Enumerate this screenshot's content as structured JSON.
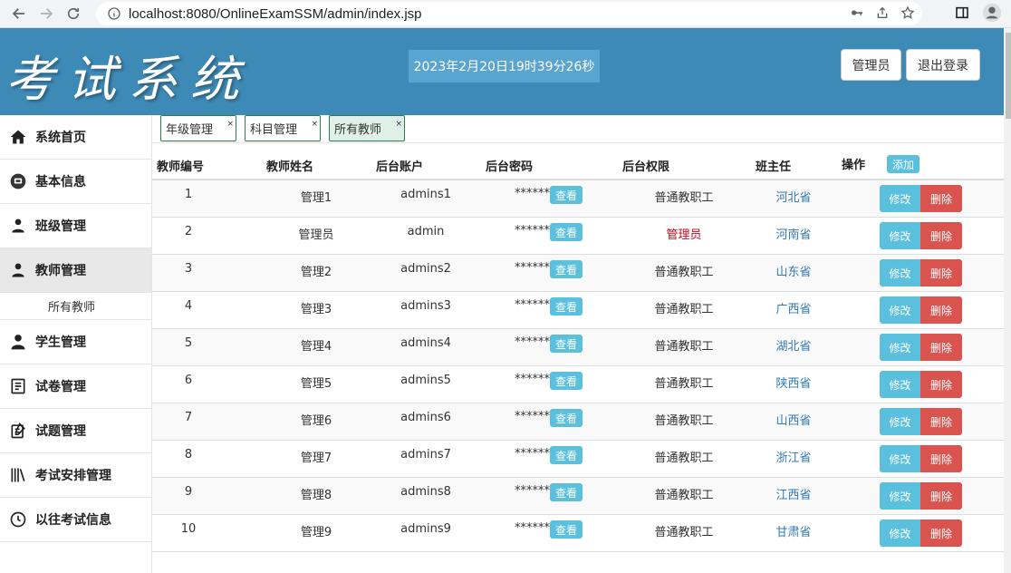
{
  "browser": {
    "url": "localhost:8080/OnlineExamSSM/admin/index.jsp"
  },
  "header": {
    "logo": "考试系统",
    "datetime": "2023年2月20日19时39分26秒",
    "role_button": "管理员",
    "logout_button": "退出登录",
    "bg_color": "#3e8ab6"
  },
  "sidebar": {
    "items": [
      {
        "label": "系统首页",
        "icon": "home-icon"
      },
      {
        "label": "基本信息",
        "icon": "info-icon"
      },
      {
        "label": "班级管理",
        "icon": "user-icon"
      },
      {
        "label": "教师管理",
        "icon": "user-icon"
      },
      {
        "label": "学生管理",
        "icon": "user-icon"
      },
      {
        "label": "试卷管理",
        "icon": "paper-icon"
      },
      {
        "label": "试题管理",
        "icon": "edit-paper-icon"
      },
      {
        "label": "考试安排管理",
        "icon": "books-icon"
      },
      {
        "label": "以往考试信息",
        "icon": "clock-icon"
      }
    ],
    "active_sub": "所有教师"
  },
  "tabs": [
    {
      "label": "年级管理"
    },
    {
      "label": "科目管理"
    },
    {
      "label": "所有教师"
    }
  ],
  "tab_close": "×",
  "table": {
    "headers": {
      "id": "教师编号",
      "name": "教师姓名",
      "account": "后台账户",
      "password": "后台密码",
      "permission": "后台权限",
      "head_teacher": "班主任",
      "actions": "操作"
    },
    "add_button": "添加",
    "view_button": "查看",
    "edit_button": "修改",
    "delete_button": "删除",
    "rows": [
      {
        "id": "1",
        "name": "管理1",
        "account": "admins1",
        "password": "******",
        "permission": "普通教职工",
        "head_teacher": "河北省"
      },
      {
        "id": "2",
        "name": "管理员",
        "account": "admin",
        "password": "******",
        "permission": "管理员",
        "head_teacher": "河南省"
      },
      {
        "id": "3",
        "name": "管理2",
        "account": "admins2",
        "password": "******",
        "permission": "普通教职工",
        "head_teacher": "山东省"
      },
      {
        "id": "4",
        "name": "管理3",
        "account": "admins3",
        "password": "******",
        "permission": "普通教职工",
        "head_teacher": "广西省"
      },
      {
        "id": "5",
        "name": "管理4",
        "account": "admins4",
        "password": "******",
        "permission": "普通教职工",
        "head_teacher": "湖北省"
      },
      {
        "id": "6",
        "name": "管理5",
        "account": "admins5",
        "password": "******",
        "permission": "普通教职工",
        "head_teacher": "陕西省"
      },
      {
        "id": "7",
        "name": "管理6",
        "account": "admins6",
        "password": "******",
        "permission": "普通教职工",
        "head_teacher": "山西省"
      },
      {
        "id": "8",
        "name": "管理7",
        "account": "admins7",
        "password": "******",
        "permission": "普通教职工",
        "head_teacher": "浙江省"
      },
      {
        "id": "9",
        "name": "管理8",
        "account": "admins8",
        "password": "******",
        "permission": "普通教职工",
        "head_teacher": "江西省"
      },
      {
        "id": "10",
        "name": "管理9",
        "account": "admins9",
        "password": "******",
        "permission": "普通教职工",
        "head_teacher": "甘肃省"
      }
    ]
  }
}
